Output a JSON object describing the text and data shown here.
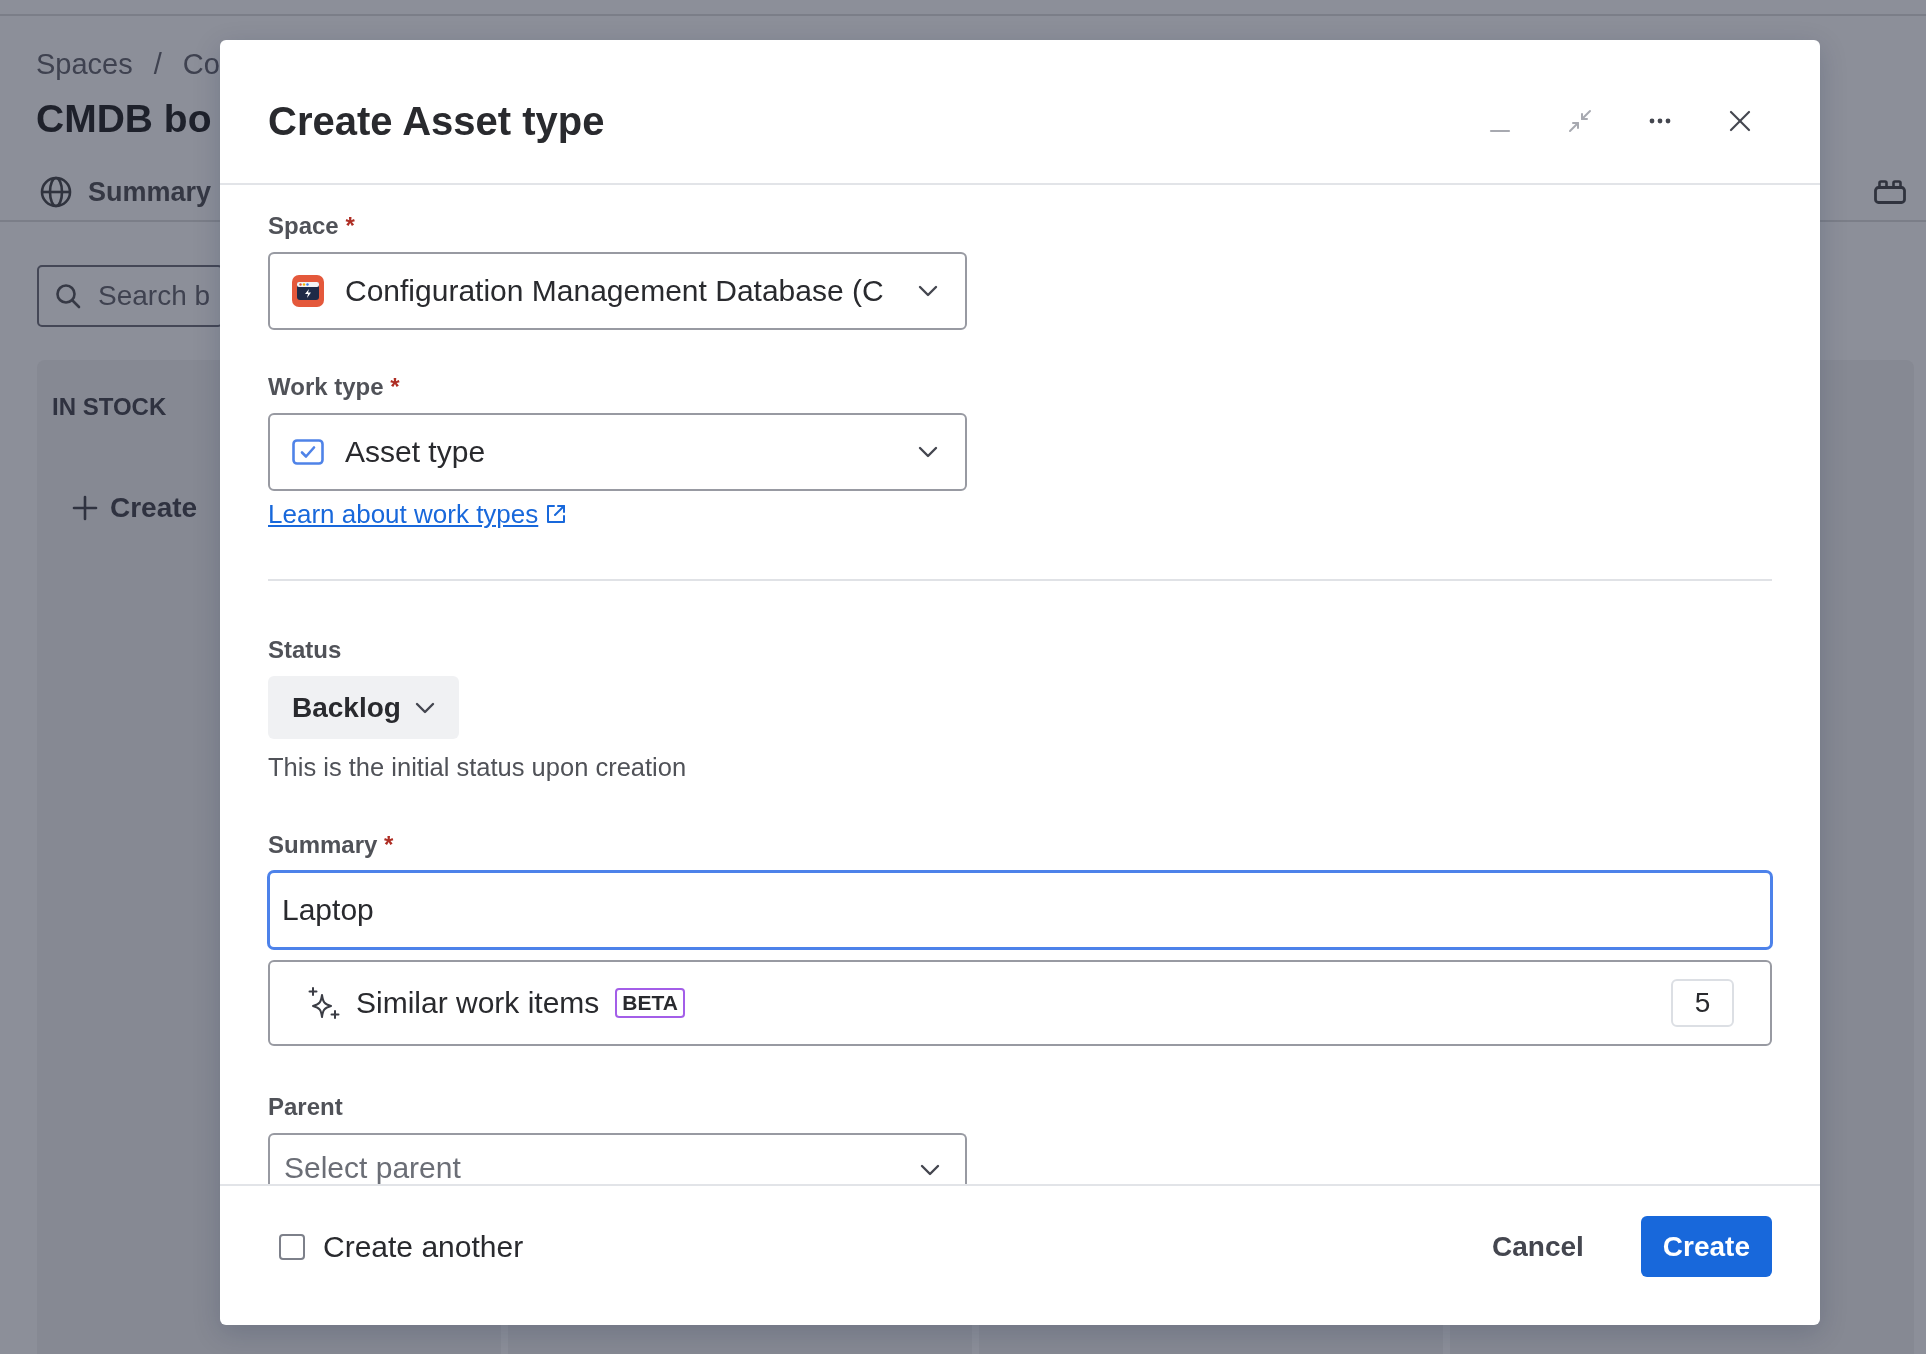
{
  "background_page": {
    "breadcrumbs": [
      {
        "label": "Spaces"
      },
      {
        "label": "Co"
      }
    ],
    "breadcrumb_separator": "/",
    "title": "CMDB bo",
    "tabs": [
      {
        "label": "Summary",
        "selected": false
      }
    ],
    "search": {
      "placeholder": "Search b"
    },
    "board": {
      "columns": [
        {
          "title": "IN STOCK",
          "create_label": "Create"
        }
      ]
    }
  },
  "dialog": {
    "title": "Create Asset type",
    "header_actions": [
      {
        "kind": "minimize",
        "disabled": true
      },
      {
        "kind": "shrink",
        "disabled": true
      },
      {
        "kind": "more",
        "disabled": false
      },
      {
        "kind": "close",
        "disabled": false
      }
    ],
    "space": {
      "label": "Space",
      "required_mark": "*",
      "value": "Configuration Management Database (C"
    },
    "work_type": {
      "label": "Work type",
      "required_mark": "*",
      "value": "Asset type",
      "help_link": "Learn about work types"
    },
    "status": {
      "label": "Status",
      "value": "Backlog",
      "hint": "This is the initial status upon creation"
    },
    "summary": {
      "label": "Summary",
      "required_mark": "*",
      "value": "Laptop",
      "focused": true
    },
    "similar_items": {
      "label": "Similar work items",
      "badge": "BETA",
      "count": "5"
    },
    "parent": {
      "label": "Parent",
      "placeholder": "Select parent"
    },
    "footer": {
      "create_another": {
        "label": "Create another",
        "checked": false
      },
      "buttons": [
        {
          "label": "Cancel",
          "kind": "subtle"
        },
        {
          "label": "Create",
          "kind": "primary"
        }
      ]
    }
  }
}
